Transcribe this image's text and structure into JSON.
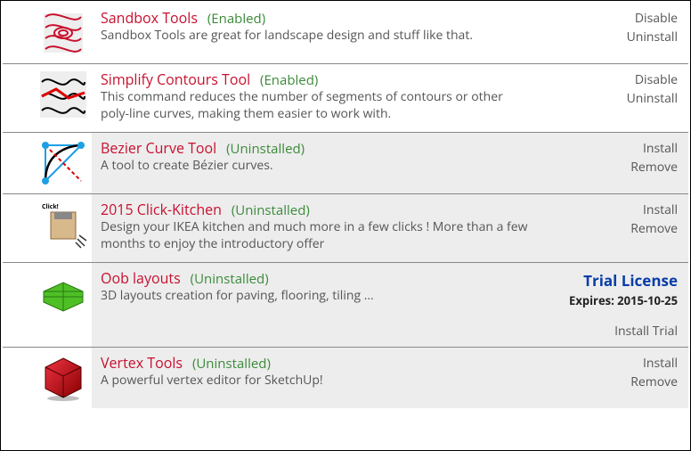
{
  "extensions": [
    {
      "name": "Sandbox Tools",
      "status": "(Enabled)",
      "desc": "Sandbox Tools are great for landscape design and stuff like that.",
      "state": "enabled",
      "action1": "Disable",
      "action2": "Uninstall"
    },
    {
      "name": "Simplify Contours Tool",
      "status": "(Enabled)",
      "desc": "This command reduces the number of segments of contours or other poly-line curves, making them easier to work with.",
      "state": "enabled",
      "action1": "Disable",
      "action2": "Uninstall"
    },
    {
      "name": "Bezier Curve Tool",
      "status": "(Uninstalled)",
      "desc": "A tool to create Bézier curves.",
      "state": "uninstalled",
      "action1": "Install",
      "action2": "Remove"
    },
    {
      "name": "2015 Click-Kitchen",
      "status": "(Uninstalled)",
      "desc": "Design your IKEA kitchen and much more in a few clicks ! More than a few months to enjoy the introductory offer",
      "state": "uninstalled",
      "action1": "Install",
      "action2": "Remove"
    },
    {
      "name": "Oob layouts",
      "status": "(Uninstalled)",
      "desc": "3D layouts creation for paving, flooring, tiling ...",
      "state": "uninstalled",
      "trial_title": "Trial License",
      "trial_expires": "Expires: 2015-10-25",
      "action1": "Install Trial"
    },
    {
      "name": "Vertex Tools",
      "status": "(Uninstalled)",
      "desc": "A powerful vertex editor for SketchUp!",
      "state": "uninstalled",
      "action1": "Install",
      "action2": "Remove"
    }
  ]
}
